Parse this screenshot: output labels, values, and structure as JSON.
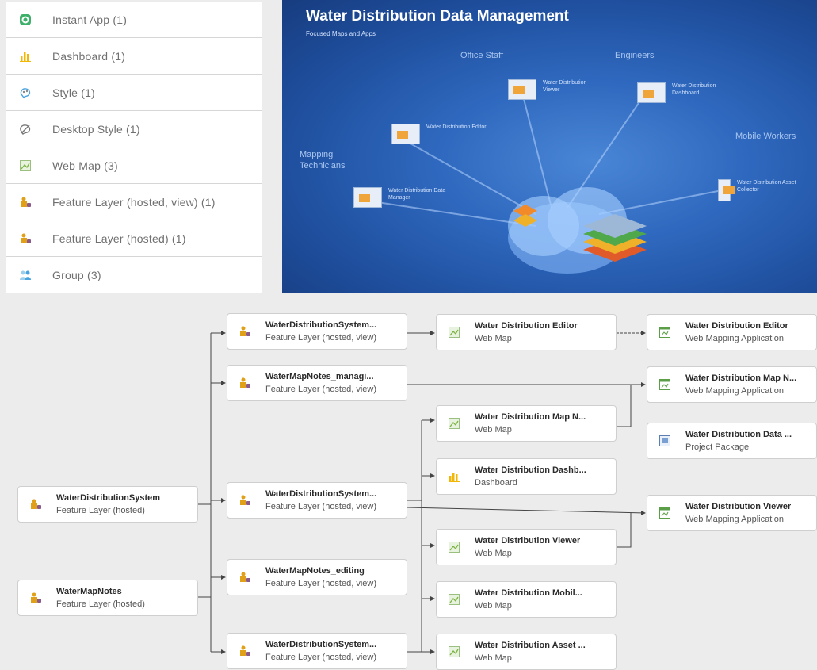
{
  "legend": {
    "items": [
      {
        "label": "Instant App (1)",
        "icon": "instant-app-icon"
      },
      {
        "label": "Dashboard (1)",
        "icon": "dashboard-icon"
      },
      {
        "label": "Style (1)",
        "icon": "style-icon"
      },
      {
        "label": "Desktop Style (1)",
        "icon": "desktop-style-icon"
      },
      {
        "label": "Web Map (3)",
        "icon": "web-map-icon"
      },
      {
        "label": "Feature Layer (hosted, view) (1)",
        "icon": "feature-layer-icon"
      },
      {
        "label": "Feature Layer (hosted) (1)",
        "icon": "feature-layer-icon"
      },
      {
        "label": "Group (3)",
        "icon": "group-icon"
      }
    ]
  },
  "hero": {
    "title": "Water Distribution Data Management",
    "subtitle": "Focused Maps and Apps",
    "groups": {
      "office_staff": "Office Staff",
      "engineers": "Engineers",
      "mapping_technicians": "Mapping Technicians",
      "mobile_workers": "Mobile Workers"
    },
    "apps": {
      "viewer": "Water Distribution Viewer",
      "dashboard": "Water Distribution Dashboard",
      "editor": "Water Distribution Editor",
      "data_manager": "Water Distribution Data Manager",
      "asset_collector": "Water Distribution Asset Collector"
    }
  },
  "diagram": {
    "sources": [
      {
        "title": "WaterDistributionSystem",
        "type": "Feature Layer (hosted)"
      },
      {
        "title": "WaterMapNotes",
        "type": "Feature Layer (hosted)"
      }
    ],
    "views": [
      {
        "title": "WaterDistributionSystem...",
        "type": "Feature Layer (hosted, view)"
      },
      {
        "title": "WaterMapNotes_managi...",
        "type": "Feature Layer (hosted, view)"
      },
      {
        "title": "WaterDistributionSystem...",
        "type": "Feature Layer (hosted, view)"
      },
      {
        "title": "WaterMapNotes_editing",
        "type": "Feature Layer (hosted, view)"
      },
      {
        "title": "WaterDistributionSystem...",
        "type": "Feature Layer (hosted, view)"
      }
    ],
    "maps": [
      {
        "title": "Water Distribution Editor",
        "type": "Web Map"
      },
      {
        "title": "Water Distribution Map N...",
        "type": "Web Map"
      },
      {
        "title": "Water Distribution Dashb...",
        "type": "Dashboard"
      },
      {
        "title": "Water Distribution Viewer",
        "type": "Web Map"
      },
      {
        "title": "Water Distribution Mobil...",
        "type": "Web Map"
      },
      {
        "title": "Water Distribution Asset ...",
        "type": "Web Map"
      }
    ],
    "apps": [
      {
        "title": "Water Distribution Editor",
        "type": "Web Mapping Application"
      },
      {
        "title": "Water Distribution Map N...",
        "type": "Web Mapping Application"
      },
      {
        "title": "Water Distribution Data ...",
        "type": "Project Package"
      },
      {
        "title": "Water Distribution Viewer",
        "type": "Web Mapping Application"
      }
    ]
  },
  "colors": {
    "feature_layer": "#e0a018",
    "web_map": "#7cb342",
    "dashboard": "#f2b705",
    "app": "#5a9e48",
    "group": "#4aa3df",
    "connector": "#444444"
  }
}
